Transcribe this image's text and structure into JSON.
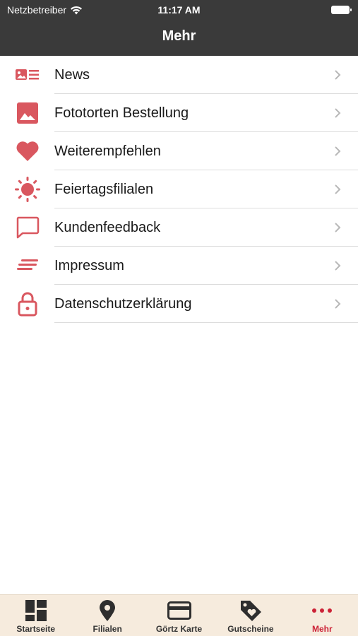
{
  "status": {
    "carrier": "Netzbetreiber",
    "time": "11:17 AM"
  },
  "header": {
    "title": "Mehr"
  },
  "colors": {
    "accent": "#d9575f",
    "header_bg": "#3a3a3a",
    "tabbar_bg": "#f6ebdd",
    "active_tab": "#cc2236"
  },
  "menu": [
    {
      "label": "News",
      "icon": "news-icon"
    },
    {
      "label": "Fototorten Bestellung",
      "icon": "image-icon"
    },
    {
      "label": "Weiterempfehlen",
      "icon": "heart-icon"
    },
    {
      "label": "Feiertagsfilialen",
      "icon": "sun-icon"
    },
    {
      "label": "Kundenfeedback",
      "icon": "chat-bubble-icon"
    },
    {
      "label": "Impressum",
      "icon": "text-lines-icon"
    },
    {
      "label": "Datenschutzerklärung",
      "icon": "lock-icon"
    }
  ],
  "tabs": [
    {
      "label": "Startseite",
      "icon": "dashboard-icon",
      "active": false
    },
    {
      "label": "Filialen",
      "icon": "location-pin-icon",
      "active": false
    },
    {
      "label": "Görtz Karte",
      "icon": "card-icon",
      "active": false
    },
    {
      "label": "Gutscheine",
      "icon": "tag-icon",
      "active": false
    },
    {
      "label": "Mehr",
      "icon": "more-dots-icon",
      "active": true
    }
  ]
}
